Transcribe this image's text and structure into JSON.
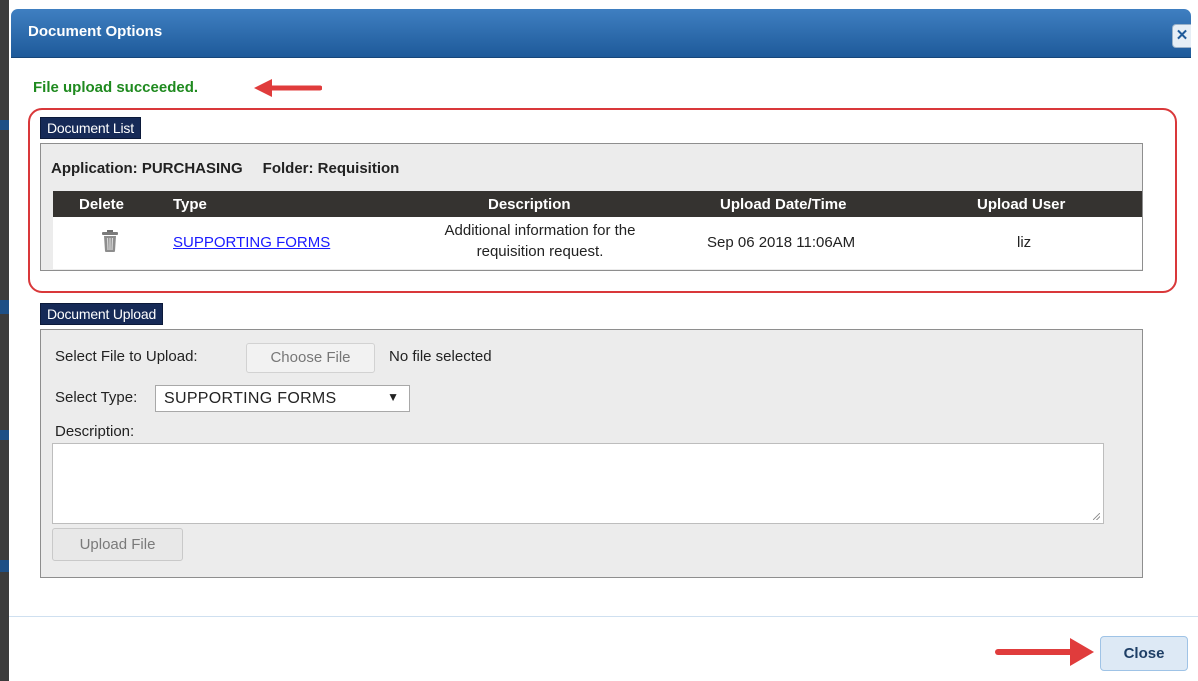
{
  "dialog": {
    "title": "Document Options",
    "close_icon": "close-x-icon",
    "status_message": "File upload succeeded.",
    "close_button_label": "Close"
  },
  "document_list": {
    "legend": "Document List",
    "application_label": "Application: PURCHASING",
    "folder_label": "Folder: Requisition",
    "columns": [
      "Delete",
      "Type",
      "Description",
      "Upload Date/Time",
      "Upload User"
    ],
    "rows": [
      {
        "delete_icon": "trash-icon",
        "type": "SUPPORTING FORMS",
        "description": "Additional information for the requisition request.",
        "upload_datetime": "Sep 06 2018 11:06AM",
        "upload_user": "liz"
      }
    ]
  },
  "document_upload": {
    "legend": "Document Upload",
    "select_file_label": "Select File to Upload:",
    "choose_file_label": "Choose File",
    "no_file_text": "No file selected",
    "select_type_label": "Select Type:",
    "select_type_value": "SUPPORTING FORMS",
    "description_label": "Description:",
    "description_value": "",
    "upload_button_label": "Upload File"
  },
  "annotations": {
    "arrow_color": "#e03c3c",
    "highlight_color": "#d9383a"
  },
  "colors": {
    "titlebar": "#2b6cad",
    "success_text": "#1f8a1f",
    "legend_bg": "#162a57",
    "table_header_bg": "#353330",
    "link": "#1a1aff"
  }
}
